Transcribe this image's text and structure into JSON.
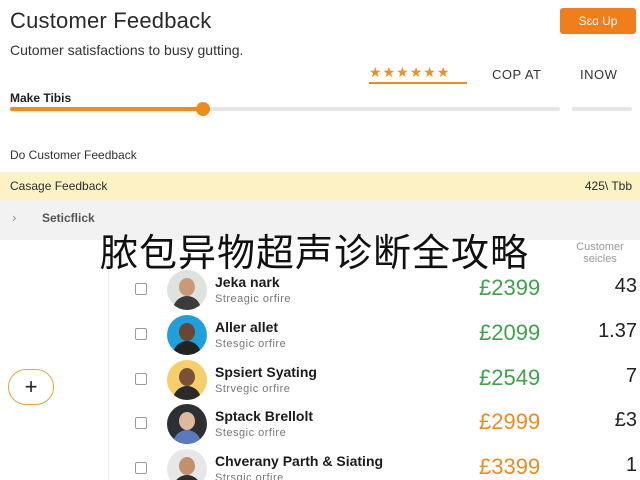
{
  "header": {
    "title": "Customer Feedback",
    "subtitle": "Cutomer satisfactions to busy gutting.",
    "signup_label": "Sɛɑ Up"
  },
  "rating": {
    "stars": 6,
    "star_glyph": "★",
    "color": "#f0901e"
  },
  "tabs": [
    {
      "label": "COP AT"
    },
    {
      "label": "INOW"
    }
  ],
  "progress": {
    "label": "Make Tibis",
    "value": 0.35,
    "color": "#ef8a1e"
  },
  "section_title": "Do Customer Feedback",
  "banner": {
    "label": "Casage Feedback",
    "value": "425\\ Tbb",
    "color": "#fdf2c4"
  },
  "subsection": {
    "chevron": "›",
    "label": "Seticflick"
  },
  "overlay_text": "脓包异物超声诊断全攻略",
  "columns": {
    "customer_header": "Customer\nseicles"
  },
  "rows": [
    {
      "name": "Jeka nark",
      "role": "Streagic orfire",
      "price": "£2399",
      "price_color": "#3fa24a",
      "score": "43",
      "avatar_bg": "#dfe3df",
      "skin": "#c89a7a",
      "shirt": "#3b3b3b"
    },
    {
      "name": "Aller allet",
      "role": "Stesgic orfire",
      "price": "£2099",
      "price_color": "#3fa24a",
      "score": "1.37",
      "avatar_bg": "#1fa0dd",
      "skin": "#6b4630",
      "shirt": "#222222"
    },
    {
      "name": "Spsiert Syating",
      "role": "Strvegic orfire",
      "price": "£2549",
      "price_color": "#3fa24a",
      "score": "7",
      "avatar_bg": "#f6cf69",
      "skin": "#7a5137",
      "shirt": "#2a2a2a"
    },
    {
      "name": "Sptack Brellolt",
      "role": "Stesgic orfire",
      "price": "£2999",
      "price_color": "#ef8a1e",
      "score": "£3",
      "avatar_bg": "#2c2f33",
      "skin": "#e0b89a",
      "shirt": "#5a7ac0"
    },
    {
      "name": "Chverany Parth & Siating",
      "role": "Strsgic orfire",
      "price": "£3399",
      "price_color": "#ef8a1e",
      "score": "1",
      "avatar_bg": "#e7e7e7",
      "skin": "#c48f6d",
      "shirt": "#2d2d2d"
    }
  ],
  "fab": {
    "label": "+"
  }
}
